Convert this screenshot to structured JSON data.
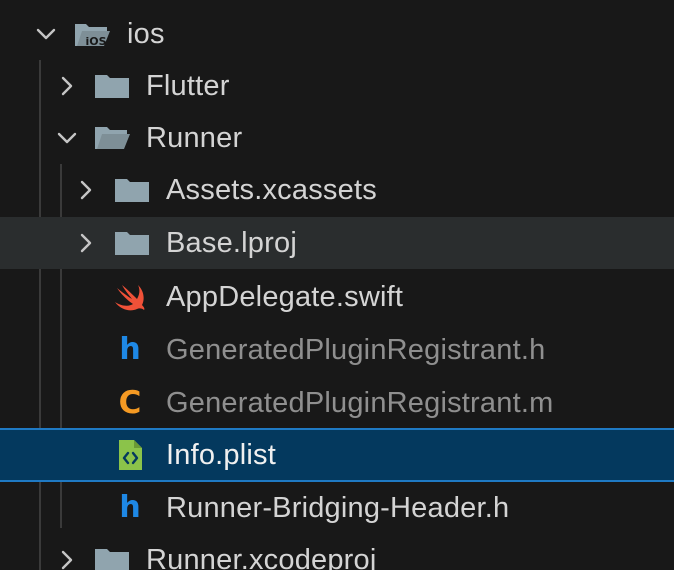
{
  "explorer": {
    "items": [
      {
        "label": "ios",
        "chevron": "chevron-down",
        "icon": "folder-ios-open"
      },
      {
        "label": "Flutter",
        "chevron": "chevron-right",
        "icon": "folder-closed"
      },
      {
        "label": "Runner",
        "chevron": "chevron-down",
        "icon": "folder-open"
      },
      {
        "label": "Assets.xcassets",
        "chevron": "chevron-right",
        "icon": "folder-closed"
      },
      {
        "label": "Base.lproj",
        "chevron": "chevron-right",
        "icon": "folder-closed",
        "state": "hover"
      },
      {
        "label": "AppDelegate.swift",
        "icon": "swift-file-icon"
      },
      {
        "label": "GeneratedPluginRegistrant.h",
        "icon": "h-file-icon",
        "git_status": "ignored"
      },
      {
        "label": "GeneratedPluginRegistrant.m",
        "icon": "objc-file-icon",
        "git_status": "ignored"
      },
      {
        "label": "Info.plist",
        "icon": "plist-file-icon",
        "state": "selected"
      },
      {
        "label": "Runner-Bridging-Header.h",
        "icon": "h-file-icon"
      },
      {
        "label": "Runner.xcodeproj",
        "chevron": "chevron-right",
        "icon": "folder-closed"
      }
    ],
    "folder_icon_badge": "iOS"
  },
  "colors": {
    "background": "#181818",
    "hover_row": "#2a2d2e",
    "selected_row": "#04395e",
    "selected_border": "#1f7ac4",
    "folder": "#90a4ae",
    "swift": "#f05138",
    "header_h": "#1e88e5",
    "objc_c": "#f59a23",
    "plist": "#8bc34a",
    "text": "#d4d4d4",
    "text_dim": "#8f8f8f"
  }
}
